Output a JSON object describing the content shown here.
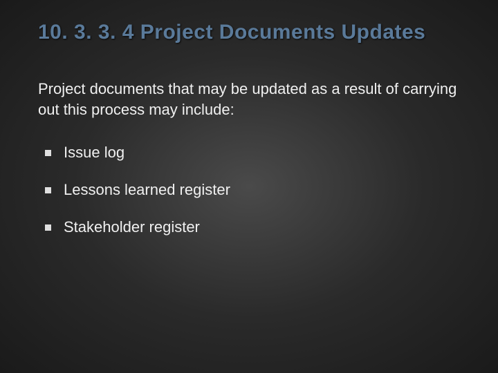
{
  "title": "10. 3. 3. 4 Project Documents Updates",
  "intro": "Project documents that may be updated as a result of carrying out this process may include:",
  "bullets": [
    "Issue log",
    "Lessons learned register",
    "Stakeholder register"
  ]
}
